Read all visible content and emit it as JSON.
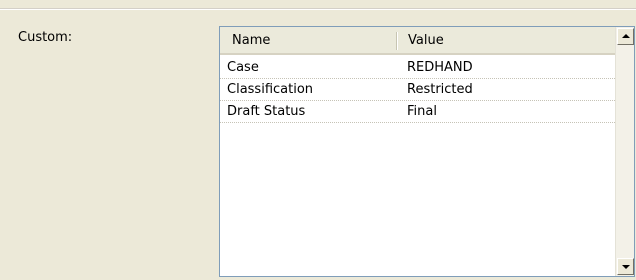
{
  "label": "Custom:",
  "table": {
    "columns": [
      "Name",
      "Value"
    ],
    "rows": [
      {
        "name": "Case",
        "value": "REDHAND"
      },
      {
        "name": "Classification",
        "value": "Restricted"
      },
      {
        "name": "Draft Status",
        "value": "Final"
      }
    ]
  },
  "icons": {
    "scroll_up": "triangle-up",
    "scroll_down": "triangle-down"
  }
}
